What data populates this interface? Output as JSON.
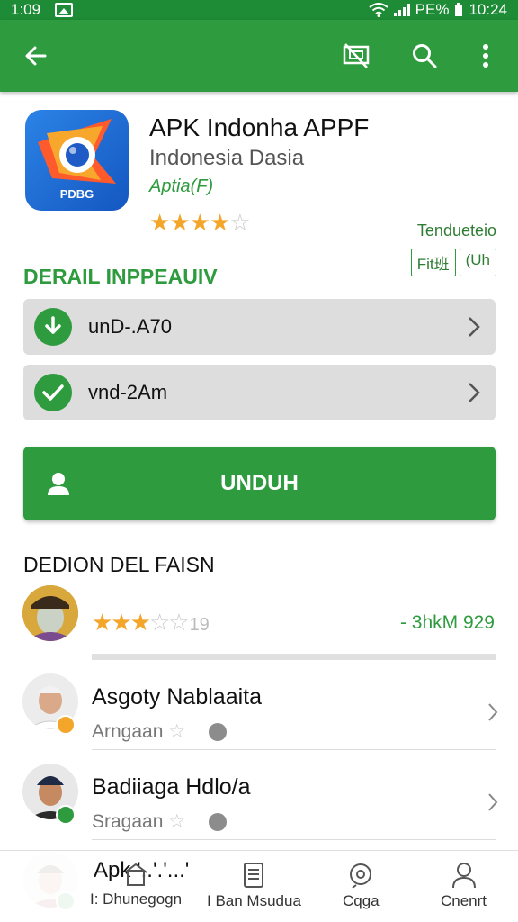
{
  "status_bar": {
    "time_left": "1:09",
    "battery": "PE%",
    "time_right": "10:24"
  },
  "app_bar": {
    "back_icon": "arrow-left-icon",
    "cast_icon": "screen-cast-icon",
    "search_icon": "search-icon",
    "more_icon": "more-vert-icon"
  },
  "app": {
    "title": "APK Indonha APPF",
    "developer": "Indonesia Dasia",
    "category": "Aptia(F)",
    "icon_text": "PDBG",
    "rating_stars": 4,
    "rating_max": 5
  },
  "trending": {
    "label": "Tendueteio",
    "tags": [
      "Fit班",
      "(Uh"
    ]
  },
  "detail": {
    "section_title": "DERAIL INPPEAUIV",
    "rows": [
      {
        "label": "unD-.A70",
        "icon": "download-icon"
      },
      {
        "label": "vnd-2Am",
        "icon": "check-icon"
      }
    ]
  },
  "install_button": {
    "label": "UNDUH",
    "icon": "person-icon"
  },
  "reviews": {
    "section_title": "DEDION DEL FAISN",
    "summary_stars": 3,
    "summary_number": "19",
    "count": "- 3hkM 929",
    "items": [
      {
        "name": "Asgoty Nablaaita",
        "sub": "Arngaan",
        "badge_color": "#f4a62a"
      },
      {
        "name": "Badiiaga Hdlo/a",
        "sub": "Sragaan",
        "badge_color": "#2e9b3e"
      }
    ],
    "peek_name": "Apk '..'.'...'"
  },
  "bottom_nav": [
    {
      "label": "I: Dhunegogn",
      "icon": "home-icon"
    },
    {
      "label": "I Ban Msudua",
      "icon": "document-icon"
    },
    {
      "label": "Cqga",
      "icon": "search-icon"
    },
    {
      "label": "Cnenrt",
      "icon": "person-icon"
    }
  ],
  "colors": {
    "primary": "#2e9b3e",
    "status": "#1e8b36",
    "star": "#f4a62a"
  }
}
